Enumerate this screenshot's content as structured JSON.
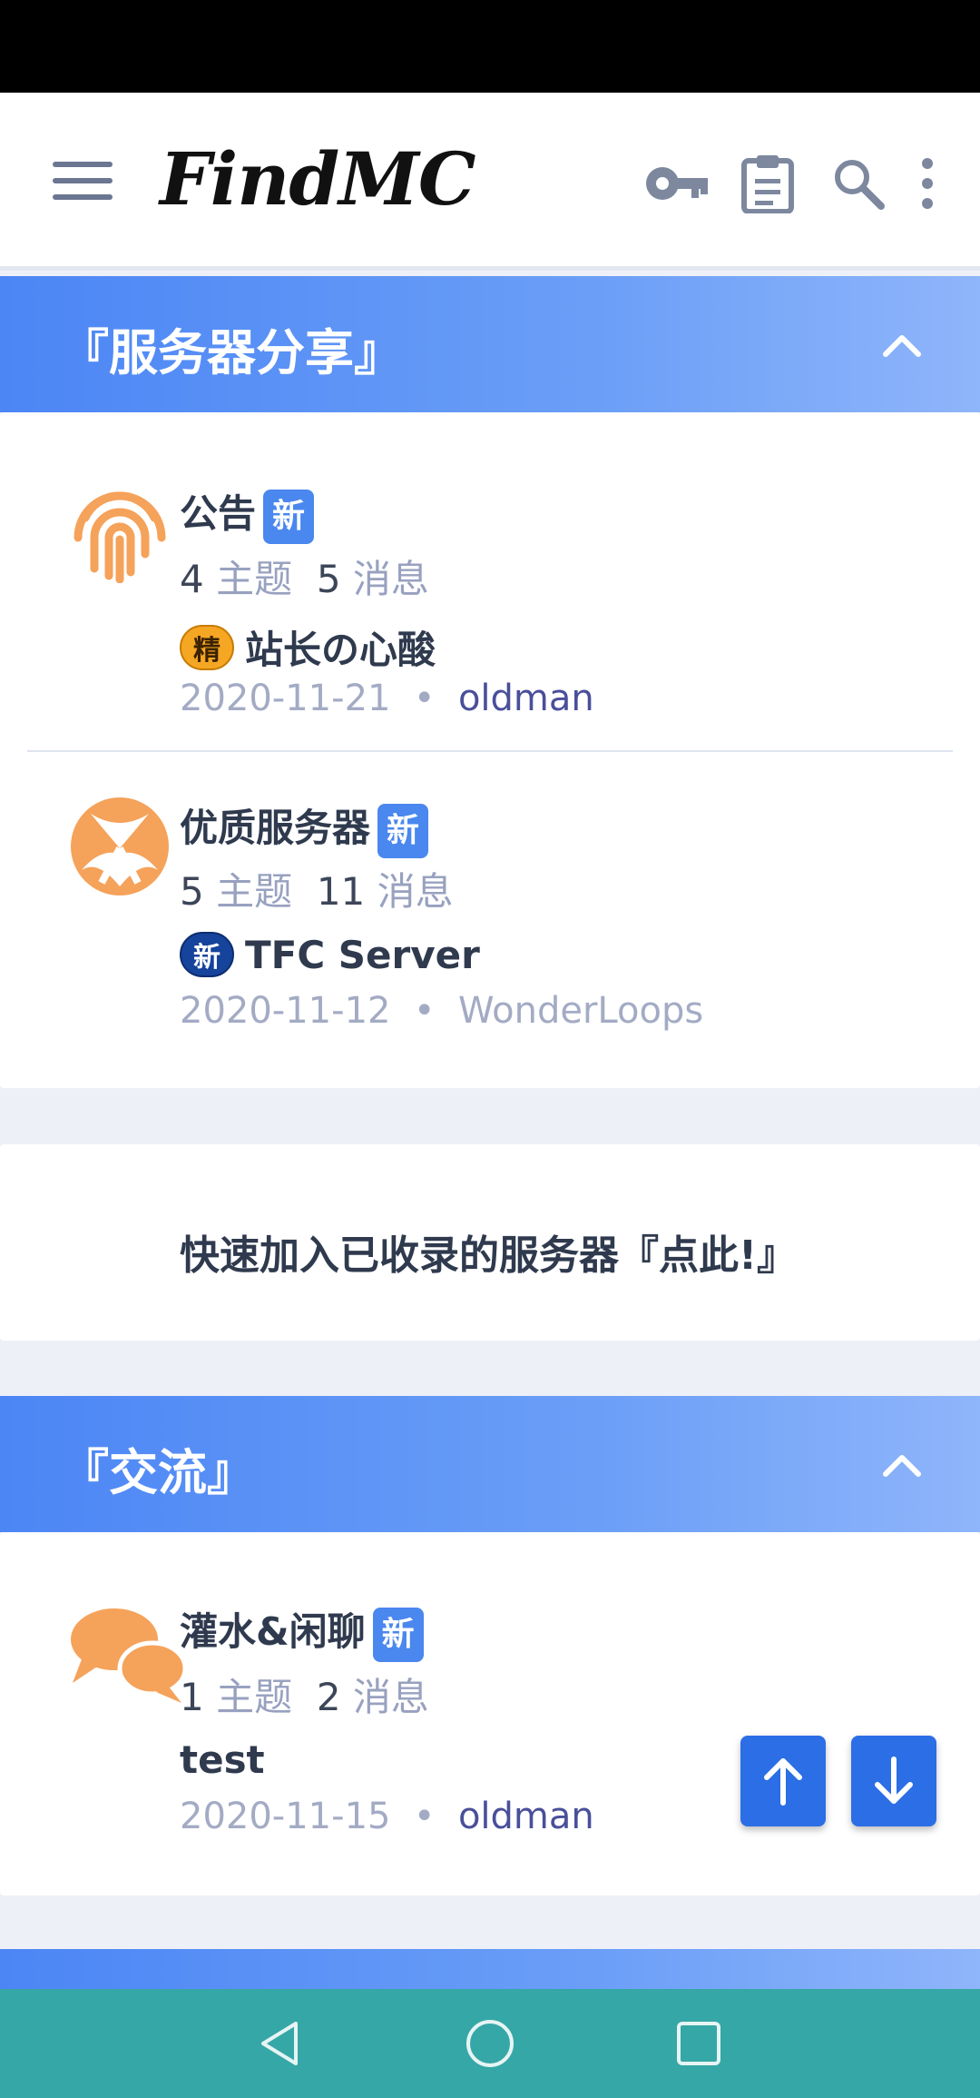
{
  "app": {
    "title": "FindMC"
  },
  "sections": [
    {
      "title": "『服务器分享』",
      "forums": [
        {
          "name": "公告",
          "badge": "新",
          "threads": "4",
          "threads_label": "主题",
          "messages": "5",
          "messages_label": "消息",
          "latest_prefix": "精",
          "latest_title": "站长の心酸",
          "latest_date": "2020-11-21",
          "latest_user": "oldman",
          "icon": "fingerprint-icon"
        },
        {
          "name": "优质服务器",
          "badge": "新",
          "threads": "5",
          "threads_label": "主题",
          "messages": "11",
          "messages_label": "消息",
          "latest_prefix": "新",
          "latest_title": "TFC Server",
          "latest_date": "2020-11-12",
          "latest_user": "WonderLoops",
          "icon": "xbox-icon"
        }
      ]
    },
    {
      "title": "『交流』",
      "forums": [
        {
          "name": "灌水&闲聊",
          "badge": "新",
          "threads": "1",
          "threads_label": "主题",
          "messages": "2",
          "messages_label": "消息",
          "latest_title": "test",
          "latest_date": "2020-11-15",
          "latest_user": "oldman",
          "icon": "chat-bubbles-icon"
        }
      ]
    }
  ],
  "quick_join": {
    "label": "快速加入已收录的服务器『点此!』"
  },
  "meta_separator": "•",
  "colors": {
    "accent": "#4c86f5",
    "icon_orange": "#f5a25a",
    "nav_bar": "#35a7a6"
  }
}
